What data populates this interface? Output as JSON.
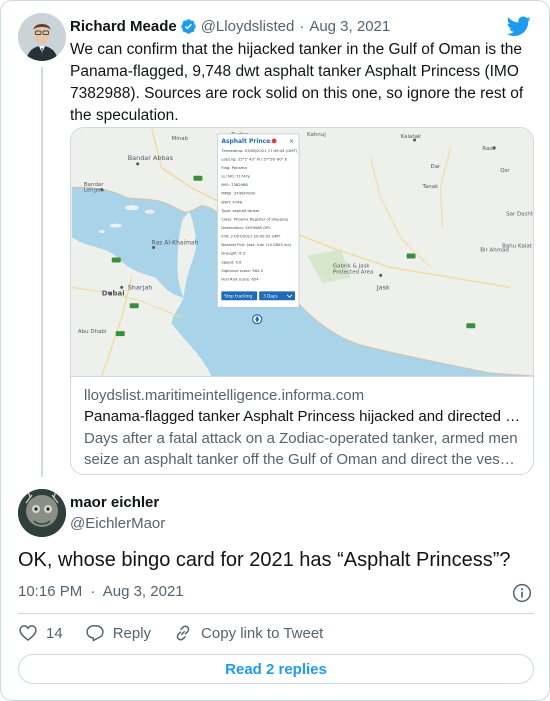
{
  "parent_tweet": {
    "author_name": "Richard Meade",
    "handle": "@Lloydslisted",
    "separator": "·",
    "date": "Aug 3, 2021",
    "text": "We can confirm that the hijacked tanker in the Gulf of Oman is the Panama-flagged, 9,748 dwt asphalt tanker Asphalt Princess (IMO 7382988). Sources are rock solid on this one, so ignore the rest of the speculation.",
    "link_card": {
      "domain": "lloydslist.maritimeintelligence.informa.com",
      "title": "Panama-flagged tanker Asphalt Princess hijacked and directed …",
      "description": "Days after a fatal attack on a Zodiac-operated tanker, armed men seize an asphalt tanker off the Gulf of Oman and direct the ves…",
      "map": {
        "popup": {
          "title": "Asphalt Princess",
          "rows": [
            "Timestamp: 03/08/2021 17:49:44 (GMT)",
            "Lat/Lng: 25°2' 43\" N / 57°26' 60\" E",
            "Flag: Panama",
            "LLI NO: 7174?e",
            "IMO: 7382988",
            "MMSI: 374947000",
            "DWT: 9748",
            "Type: asphalt tanker",
            "Class: Phoenix Register of Shipping",
            "Destination: SHOMAR OPL",
            "ETA: 27/07/2021 20:00:02 GMT",
            "Nearest Port: Jask, Iran (14.0803 nm)",
            "Draught: 6.3",
            "Speed: 0.8",
            "Vigilance score: 562.5",
            "Hull Risk score: 654"
          ],
          "button_tracking": "Stop tracking",
          "button_days": "3 Days"
        },
        "labels": [
          "Bandar Abbas",
          "Bandar Lengeh",
          "Ras Al-Khaimah",
          "Dubai",
          "Sharjah",
          "Abu Dhabi",
          "Kalatak",
          "Jask",
          "Gabrik & Jask Protected Area",
          "Kahnuj",
          "Minab",
          "Rudan",
          "Tanak",
          "Dar",
          "Qsr",
          "Rask",
          "Sar Dasht",
          "Bir Ahmad",
          "Bahu Kalat"
        ]
      }
    }
  },
  "reply_tweet": {
    "author_name": "maor eichler",
    "handle": "@EichlerMaor",
    "text": "OK, whose bingo card for 2021 has “Asphalt Princess”?",
    "time": "10:16 PM",
    "separator": "·",
    "date": "Aug 3, 2021",
    "likes": "14",
    "reply_label": "Reply",
    "copy_label": "Copy link to Tweet",
    "read_replies": "Read 2 replies"
  },
  "colors": {
    "accent": "#1d9bf0",
    "secondary_text": "#536471",
    "border": "#cfd9de",
    "water": "#a9d3e8",
    "land": "#eef0ec"
  },
  "icons": [
    "verified-badge-icon",
    "twitter-bird-icon",
    "info-icon",
    "heart-icon",
    "reply-icon",
    "link-icon",
    "ship-marker-icon"
  ]
}
